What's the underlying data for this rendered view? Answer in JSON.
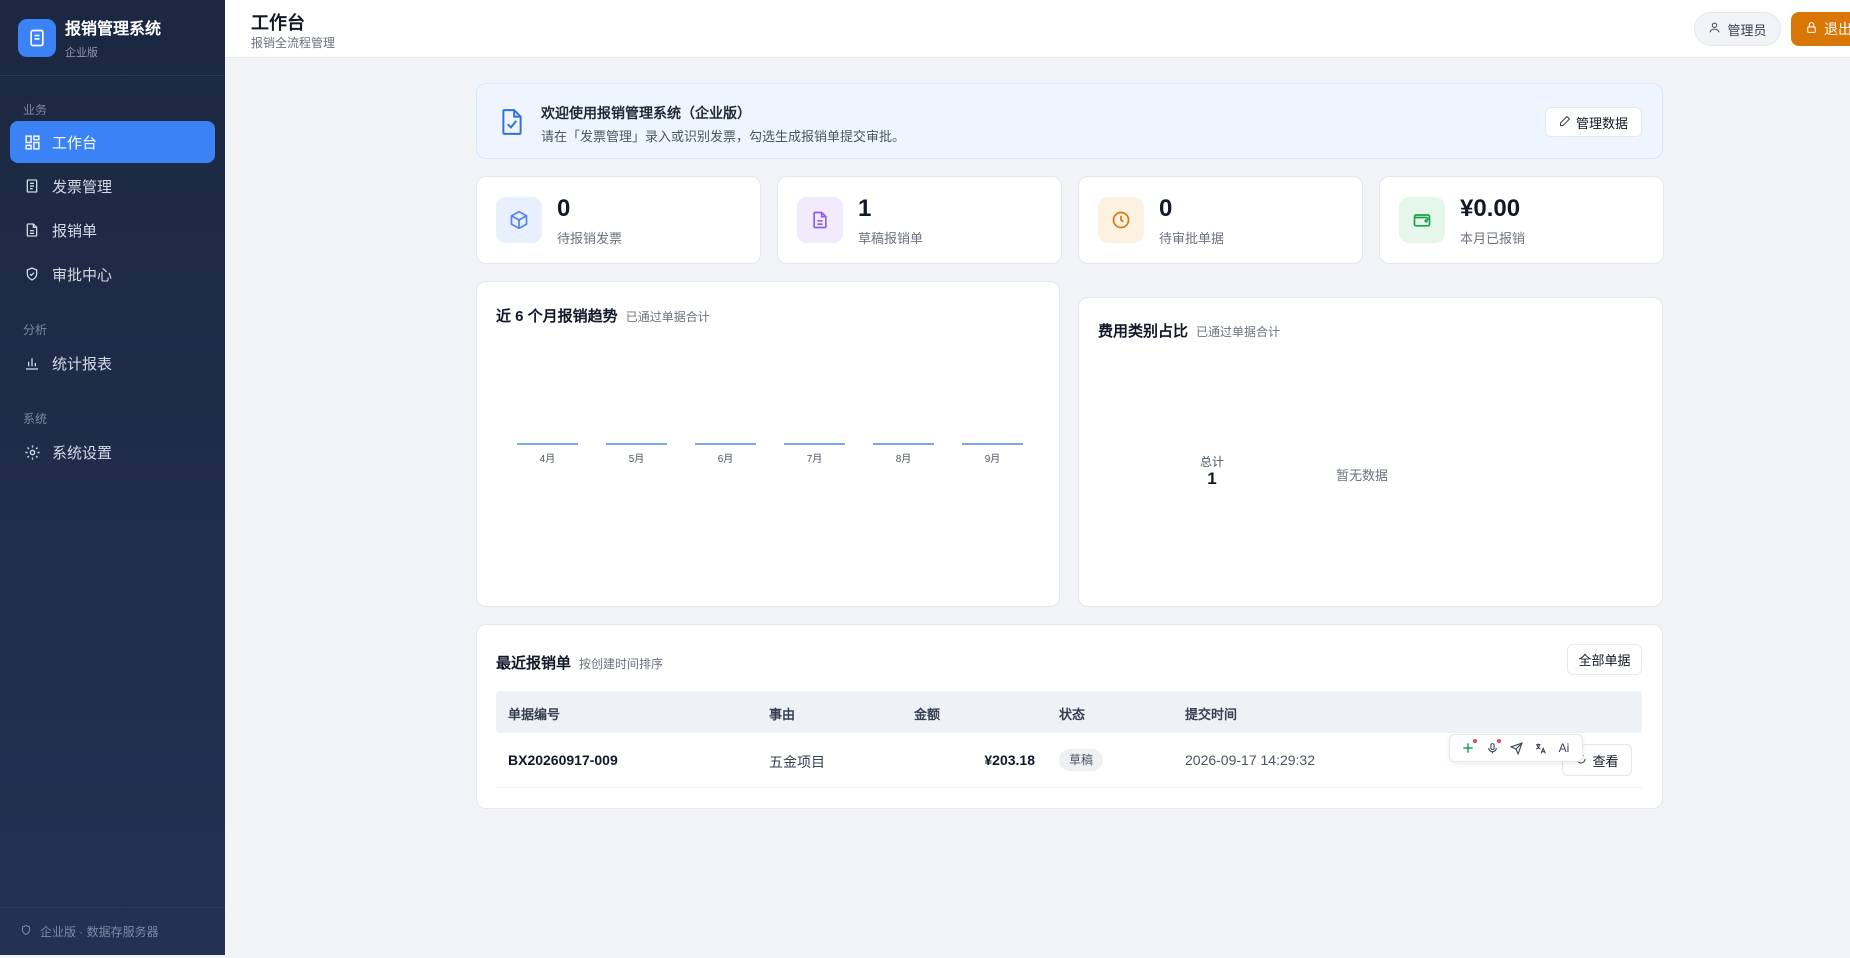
{
  "brand": {
    "title": "报销管理系统",
    "subtitle": "企业版"
  },
  "sidebar": {
    "sections": [
      {
        "label": "业务"
      },
      {
        "label": "分析"
      },
      {
        "label": "系统"
      }
    ],
    "items": [
      {
        "label": "工作台",
        "icon": "dashboard-icon",
        "active": true
      },
      {
        "label": "发票管理",
        "icon": "invoice-icon"
      },
      {
        "label": "报销单",
        "icon": "document-icon"
      },
      {
        "label": "审批中心",
        "icon": "shield-check-icon"
      },
      {
        "label": "统计报表",
        "icon": "bar-chart-icon"
      },
      {
        "label": "系统设置",
        "icon": "gear-icon"
      }
    ],
    "footer": "企业版 · 数据存服务器"
  },
  "header": {
    "title": "工作台",
    "subtitle": "报销全流程管理",
    "user": "管理员",
    "logout": "退出"
  },
  "banner": {
    "title": "欢迎使用报销管理系统（企业版）",
    "desc": "请在「发票管理」录入或识别发票，勾选生成报销单提交审批。",
    "button": "管理数据"
  },
  "stats": [
    {
      "value": "0",
      "label": "待报销发票",
      "color": "#4f7ef0",
      "bg": "#e8effd",
      "icon": "box-icon"
    },
    {
      "value": "1",
      "label": "草稿报销单",
      "color": "#8b5cf6",
      "bg": "#f1ebfd",
      "icon": "file-text-icon"
    },
    {
      "value": "0",
      "label": "待审批单据",
      "color": "#d97706",
      "bg": "#fdf1e2",
      "icon": "clock-icon"
    },
    {
      "value": "¥0.00",
      "label": "本月已报销",
      "color": "#16a34a",
      "bg": "#e5f6ea",
      "icon": "wallet-icon"
    }
  ],
  "trend": {
    "title": "近 6 个月报销趋势",
    "subtitle": "已通过单据合计"
  },
  "chart_data": {
    "type": "bar",
    "categories": [
      "4月",
      "5月",
      "6月",
      "7月",
      "8月",
      "9月"
    ],
    "values": [
      0,
      0,
      0,
      0,
      0,
      0
    ],
    "title": "近 6 个月报销趋势",
    "subtitle": "已通过单据合计"
  },
  "category": {
    "title": "费用类别占比",
    "subtitle": "已通过单据合计",
    "total_label": "总计",
    "total_value": "1",
    "empty": "暂无数据"
  },
  "recent": {
    "title": "最近报销单",
    "subtitle": "按创建时间排序",
    "all_button": "全部单据",
    "columns": [
      "单据编号",
      "事由",
      "金额",
      "状态",
      "提交时间"
    ],
    "rows": [
      {
        "id": "BX20260917-009",
        "reason": "五金项目",
        "amount": "¥203.18",
        "status": "草稿",
        "time": "2026-09-17 14:29:32",
        "action": "查看"
      }
    ]
  },
  "toolbar": {
    "items": [
      "plus-icon",
      "mic-icon",
      "send-icon",
      "translate-icon",
      "ai-icon"
    ],
    "ai_label": "Ai"
  }
}
